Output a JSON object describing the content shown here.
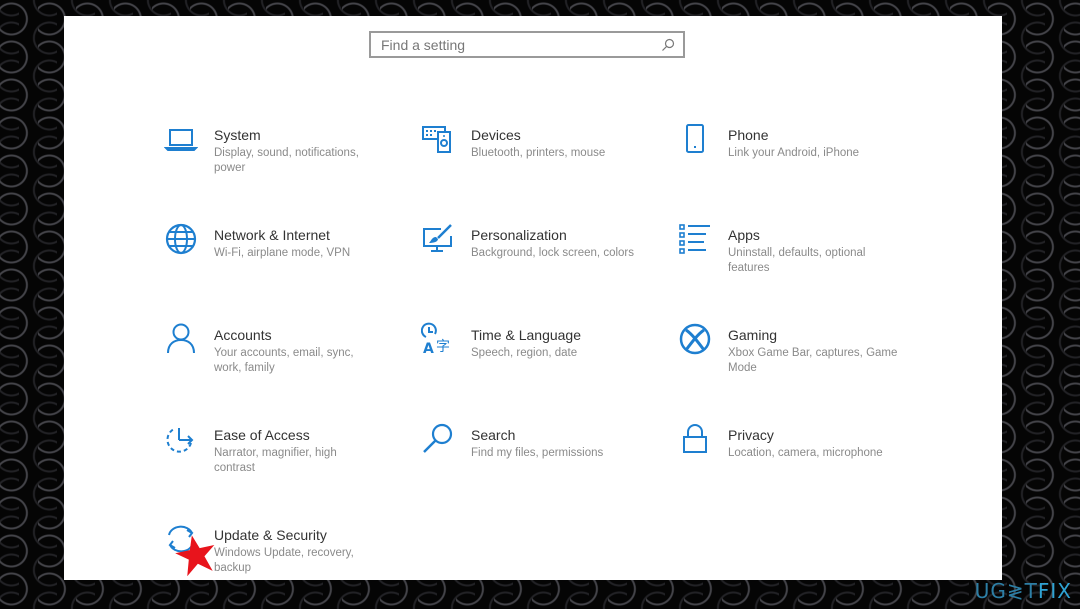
{
  "search": {
    "placeholder": "Find a setting",
    "value": ""
  },
  "accent_color": "#0078d7",
  "tiles": [
    {
      "id": "system",
      "icon": "laptop-icon",
      "title": "System",
      "desc1": "Display, sound, notifications,",
      "desc2": "power"
    },
    {
      "id": "devices",
      "icon": "devices-icon",
      "title": "Devices",
      "desc1": "Bluetooth, printers, mouse",
      "desc2": ""
    },
    {
      "id": "phone",
      "icon": "phone-icon",
      "title": "Phone",
      "desc1": "Link your Android, iPhone",
      "desc2": ""
    },
    {
      "id": "network",
      "icon": "globe-icon",
      "title": "Network & Internet",
      "desc1": "Wi-Fi, airplane mode, VPN",
      "desc2": ""
    },
    {
      "id": "personalization",
      "icon": "paintbrush-monitor-icon",
      "title": "Personalization",
      "desc1": "Background, lock screen, colors",
      "desc2": ""
    },
    {
      "id": "apps",
      "icon": "apps-list-icon",
      "title": "Apps",
      "desc1": "Uninstall, defaults, optional",
      "desc2": "features"
    },
    {
      "id": "accounts",
      "icon": "person-icon",
      "title": "Accounts",
      "desc1": "Your accounts, email, sync,",
      "desc2": "work, family"
    },
    {
      "id": "time-language",
      "icon": "time-language-icon",
      "title": "Time & Language",
      "desc1": "Speech, region, date",
      "desc2": ""
    },
    {
      "id": "gaming",
      "icon": "xbox-icon",
      "title": "Gaming",
      "desc1": "Xbox Game Bar, captures, Game",
      "desc2": "Mode"
    },
    {
      "id": "ease-of-access",
      "icon": "ease-of-access-icon",
      "title": "Ease of Access",
      "desc1": "Narrator, magnifier, high",
      "desc2": "contrast"
    },
    {
      "id": "search",
      "icon": "magnifier-icon",
      "title": "Search",
      "desc1": "Find my files, permissions",
      "desc2": ""
    },
    {
      "id": "privacy",
      "icon": "lock-icon",
      "title": "Privacy",
      "desc1": "Location, camera, microphone",
      "desc2": ""
    },
    {
      "id": "update-security",
      "icon": "sync-arrows-icon",
      "title": "Update & Security",
      "desc1": "Windows Update, recovery,",
      "desc2": "backup"
    }
  ],
  "annotation": {
    "marker": "red-star",
    "color": "#e8141c"
  },
  "watermark": {
    "part1": "UG",
    "part2": "≷T",
    "part3": "FIX"
  }
}
